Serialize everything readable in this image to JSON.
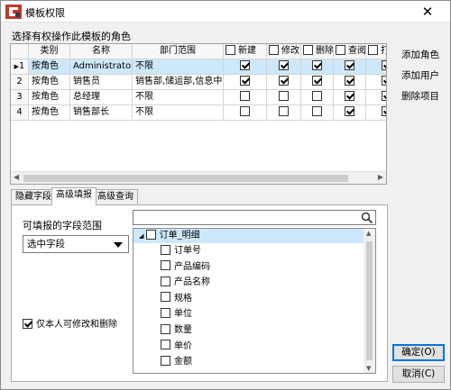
{
  "window": {
    "title": "模板权限",
    "close_glyph": "✕"
  },
  "roles_section_label": "选择有权操作此模板的角色",
  "table": {
    "columns": {
      "type": "类别",
      "name": "名称",
      "dept": "部门范围",
      "new": "新建",
      "edit": "修改",
      "delete": "删除",
      "view": "查阅",
      "print": "打印"
    },
    "rows": [
      {
        "num": "1",
        "marker": "▶",
        "type": "按角色",
        "name": "Administrators",
        "dept": "不限",
        "perms": [
          true,
          true,
          true,
          true,
          true
        ]
      },
      {
        "num": "2",
        "marker": "",
        "type": "按角色",
        "name": "销售员",
        "dept": "销售部,储运部,信息中心",
        "perms": [
          true,
          true,
          true,
          true,
          true
        ]
      },
      {
        "num": "3",
        "marker": "",
        "type": "按角色",
        "name": "总经理",
        "dept": "不限",
        "perms": [
          false,
          false,
          false,
          true,
          true
        ]
      },
      {
        "num": "4",
        "marker": "",
        "type": "按角色",
        "name": "销售部长",
        "dept": "不限",
        "perms": [
          false,
          false,
          false,
          true,
          true
        ]
      }
    ]
  },
  "side_buttons": {
    "add_role": "添加角色",
    "add_user": "添加用户",
    "delete_item": "删除项目"
  },
  "tabs": [
    "隐藏字段",
    "高级填报",
    "高级查询"
  ],
  "active_tab": "高级填报",
  "fill_panel": {
    "field_range_label": "可填报的字段范围",
    "field_range_value": "选中字段",
    "only_self_label": "仅本人可修改和删除",
    "only_self_checked": true,
    "search_placeholder": "",
    "tree_root": "订单_明细",
    "tree_items": [
      "订单号",
      "产品编码",
      "产品名称",
      "规格",
      "单位",
      "数量",
      "单价",
      "金额"
    ]
  },
  "dialog_buttons": {
    "ok": "确定(O)",
    "cancel": "取消(C)"
  }
}
